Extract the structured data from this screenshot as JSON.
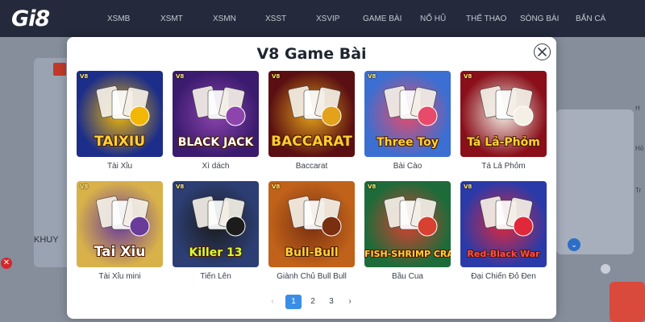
{
  "brand": {
    "logo": "Gi8"
  },
  "nav": [
    "XSMB",
    "XSMT",
    "XSMN",
    "XSST",
    "XSVIP",
    "GAME BÀI",
    "NỔ HŨ",
    "THỂ THAO",
    "SÒNG BÀI",
    "BẮN CÁ"
  ],
  "background": {
    "promo_text": "KHUY",
    "side_letters": [
      "H",
      "Hỏ",
      "Tr"
    ]
  },
  "modal": {
    "title": "V8 Game Bài",
    "thumb_brand": "V8",
    "games": [
      {
        "name": "Tài Xỉu",
        "art": "TAIXIU",
        "bg": "#1c2e8a",
        "accent": "#f2b705",
        "label_color": "#ffd23a"
      },
      {
        "name": "Xì dách",
        "art": "BLACK JACK",
        "bg": "#3a1b6e",
        "accent": "#8e44ad",
        "label_color": "#ffffff"
      },
      {
        "name": "Baccarat",
        "art": "BACCARAT",
        "bg": "#5a0f12",
        "accent": "#e3a21a",
        "label_color": "#ffcc33"
      },
      {
        "name": "Bài Cào",
        "art": "Three Toy",
        "bg": "#3b6fd1",
        "accent": "#e84a6a",
        "label_color": "#ffd23a"
      },
      {
        "name": "Tá Lả Phỏm",
        "art": "Tá Lả-Phỏm",
        "bg": "#8a0f1a",
        "accent": "#f5f0e6",
        "label_color": "#ffd23a"
      },
      {
        "name": "Tài Xỉu mini",
        "art": "Tai Xiu",
        "bg": "#d8b14a",
        "accent": "#6b3b9a",
        "label_color": "#ffffff"
      },
      {
        "name": "Tiến Lên",
        "art": "Killer 13",
        "bg": "#2c3e73",
        "accent": "#1c1c1c",
        "label_color": "#d6ff3a"
      },
      {
        "name": "Giành Chủ Bull Bull",
        "art": "Bull-Bull",
        "bg": "#c0621a",
        "accent": "#7a2f10",
        "label_color": "#ffd23a"
      },
      {
        "name": "Bầu Cua",
        "art": "FISH-SHRIMP CRAB",
        "bg": "#1e6b3a",
        "accent": "#d8402f",
        "label_color": "#ffd23a"
      },
      {
        "name": "Đại Chiến Đỏ Đen",
        "art": "Red-Black War",
        "bg": "#2a3aa8",
        "accent": "#e0283a",
        "label_color": "#ff4a5a"
      }
    ],
    "pagination": {
      "prev": "‹",
      "pages": [
        "1",
        "2",
        "3"
      ],
      "current": "1",
      "next": "›"
    }
  },
  "colors": {
    "accent": "#3a8ee6",
    "nav_bg": "#242a3b",
    "close_red": "#d6262b"
  }
}
